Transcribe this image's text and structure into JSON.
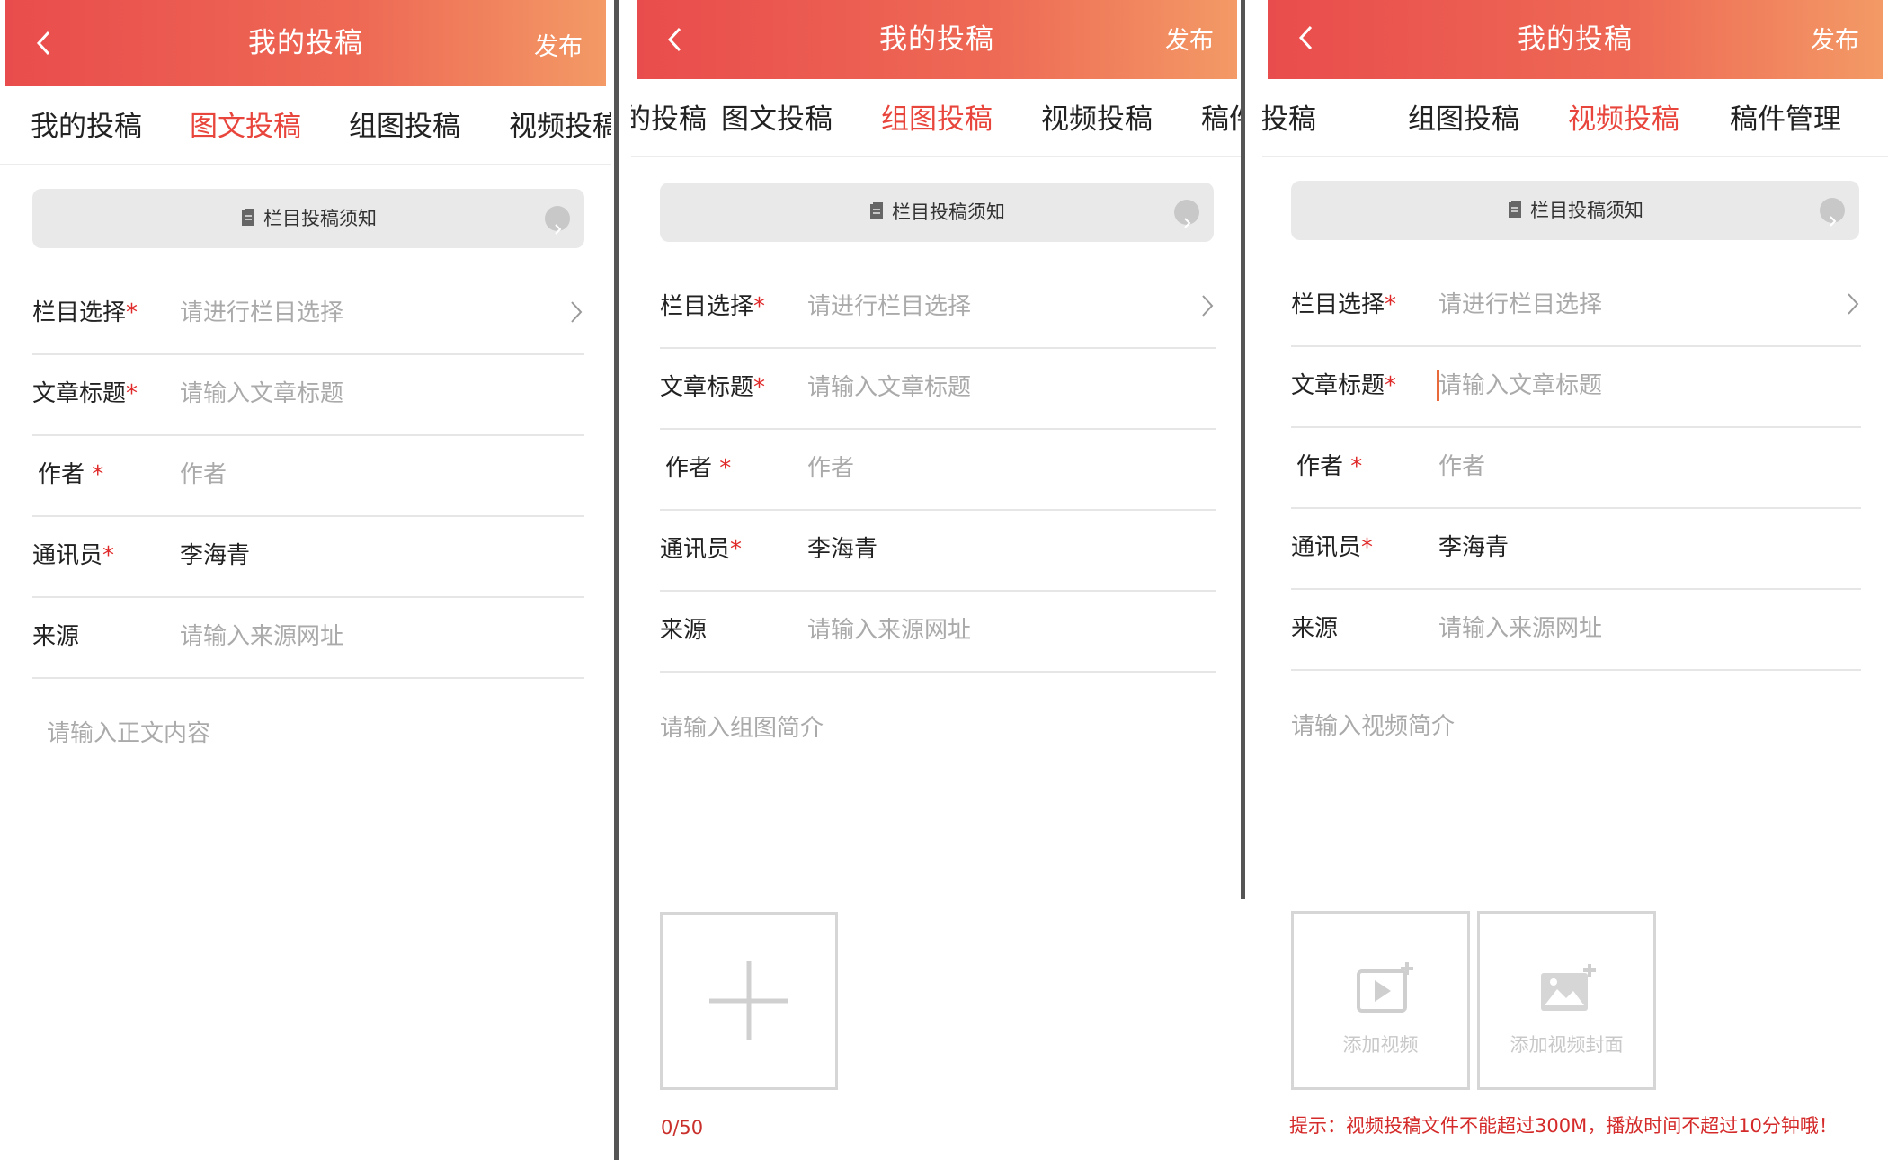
{
  "header": {
    "title": "我的投稿",
    "publish_label": "发布"
  },
  "tabs": [
    "我的投稿",
    "图文投稿",
    "组图投稿",
    "视频投稿",
    "稿件管理"
  ],
  "notice_label": "栏目投稿须知",
  "form": {
    "column_label": "栏目选择",
    "column_placeholder": "请进行栏目选择",
    "title_label": "文章标题",
    "title_placeholder": "请输入文章标题",
    "author_label": "作者",
    "author_placeholder": "作者",
    "correspondent_label": "通讯员",
    "correspondent_value": "李海青",
    "source_label": "来源",
    "source_placeholder": "请输入来源网址",
    "required_mark": "*"
  },
  "screens": {
    "graphic": {
      "active_tab": "图文投稿",
      "body_placeholder": "请输入正文内容"
    },
    "gallery": {
      "active_tab": "组图投稿",
      "body_placeholder": "请输入组图简介",
      "image_counter": "0/50",
      "add_icon": "plus-icon"
    },
    "video": {
      "active_tab": "视频投稿",
      "body_placeholder": "请输入视频简介",
      "add_video_label": "添加视频",
      "add_cover_label": "添加视频封面",
      "tip": "提示：视频投稿文件不能超过300M，播放时间不超过10分钟哦！"
    }
  },
  "colors": {
    "header_start": "#e94c4c",
    "header_end": "#f39a66",
    "accent": "#e8453c",
    "required": "#e02a2a"
  }
}
